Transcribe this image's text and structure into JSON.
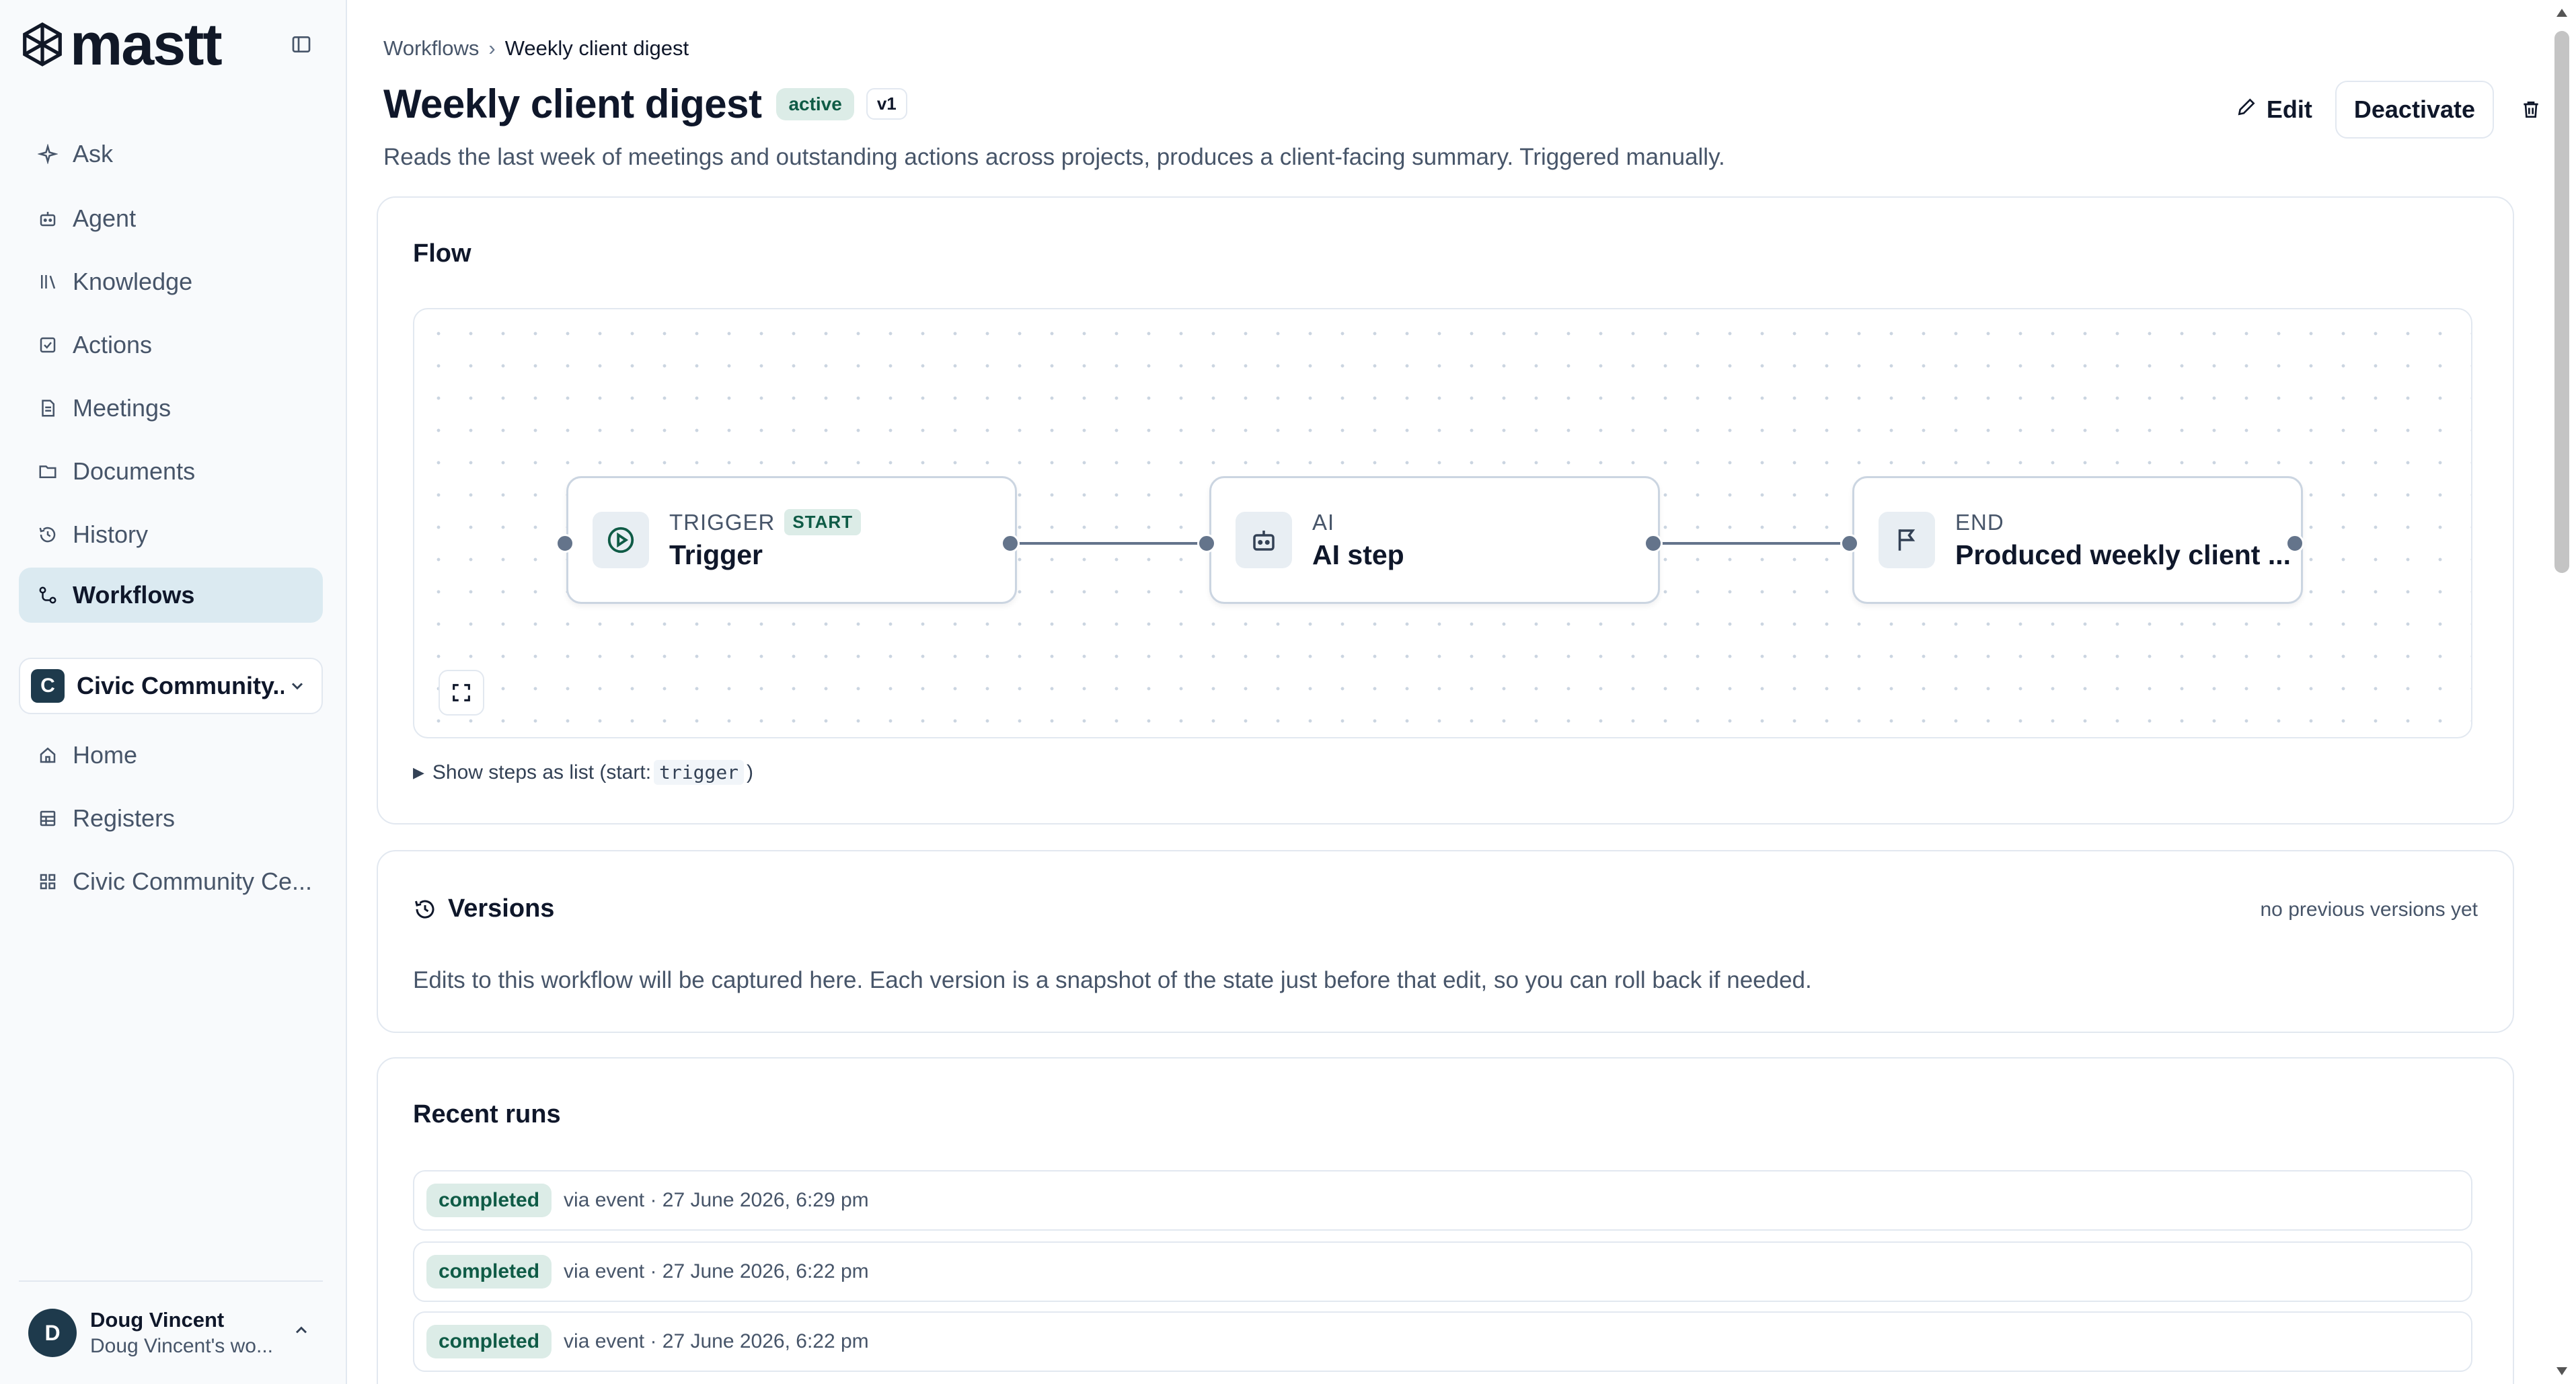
{
  "app": {
    "logo_text": "mastt"
  },
  "sidebar": {
    "items": [
      {
        "label": "Ask",
        "icon": "sparkle-icon"
      },
      {
        "label": "Agent",
        "icon": "robot-icon"
      },
      {
        "label": "Knowledge",
        "icon": "library-icon"
      },
      {
        "label": "Actions",
        "icon": "checkbox-icon"
      },
      {
        "label": "Meetings",
        "icon": "notes-icon"
      },
      {
        "label": "Documents",
        "icon": "folder-icon"
      },
      {
        "label": "History",
        "icon": "history-icon"
      },
      {
        "label": "Workflows",
        "icon": "workflow-icon",
        "active": true
      }
    ],
    "project": {
      "badge": "C",
      "name": "Civic Community..."
    },
    "project_items": [
      {
        "label": "Home",
        "icon": "home-icon"
      },
      {
        "label": "Registers",
        "icon": "table-icon"
      },
      {
        "label": "Civic Community Ce...",
        "icon": "grid-icon"
      }
    ],
    "user": {
      "initial": "D",
      "name": "Doug Vincent",
      "workspace": "Doug Vincent's wo..."
    }
  },
  "breadcrumb": {
    "parent": "Workflows",
    "current": "Weekly client digest"
  },
  "header": {
    "title": "Weekly client digest",
    "status": "active",
    "version": "v1",
    "description": "Reads the last week of meetings and outstanding actions across projects, produces a client-facing summary. Triggered manually.",
    "edit_label": "Edit",
    "deactivate_label": "Deactivate"
  },
  "flow": {
    "title": "Flow",
    "nodes": [
      {
        "type": "TRIGGER",
        "badge": "START",
        "label": "Trigger",
        "icon": "play-circle-icon"
      },
      {
        "type": "AI",
        "badge": "",
        "label": "AI step",
        "icon": "robot-icon"
      },
      {
        "type": "END",
        "badge": "",
        "label": "Produced weekly client ...",
        "icon": "flag-icon"
      }
    ],
    "list_toggle_prefix": "Show steps as list (start:",
    "list_toggle_code": "trigger",
    "list_toggle_suffix": ")"
  },
  "versions": {
    "title": "Versions",
    "status": "no previous versions yet",
    "description": "Edits to this workflow will be captured here. Each version is a snapshot of the state just before that edit, so you can roll back if needed."
  },
  "runs": {
    "title": "Recent runs",
    "items": [
      {
        "status": "completed",
        "meta": "via event · 27 June 2026, 6:29 pm"
      },
      {
        "status": "completed",
        "meta": "via event · 27 June 2026, 6:22 pm"
      },
      {
        "status": "completed",
        "meta": "via event · 27 June 2026, 6:22 pm"
      }
    ]
  },
  "colors": {
    "accent": "#dbeaf1",
    "success_bg": "#dcece7",
    "success_text": "#0f5b46",
    "brand_dark": "#1e3a4c"
  }
}
